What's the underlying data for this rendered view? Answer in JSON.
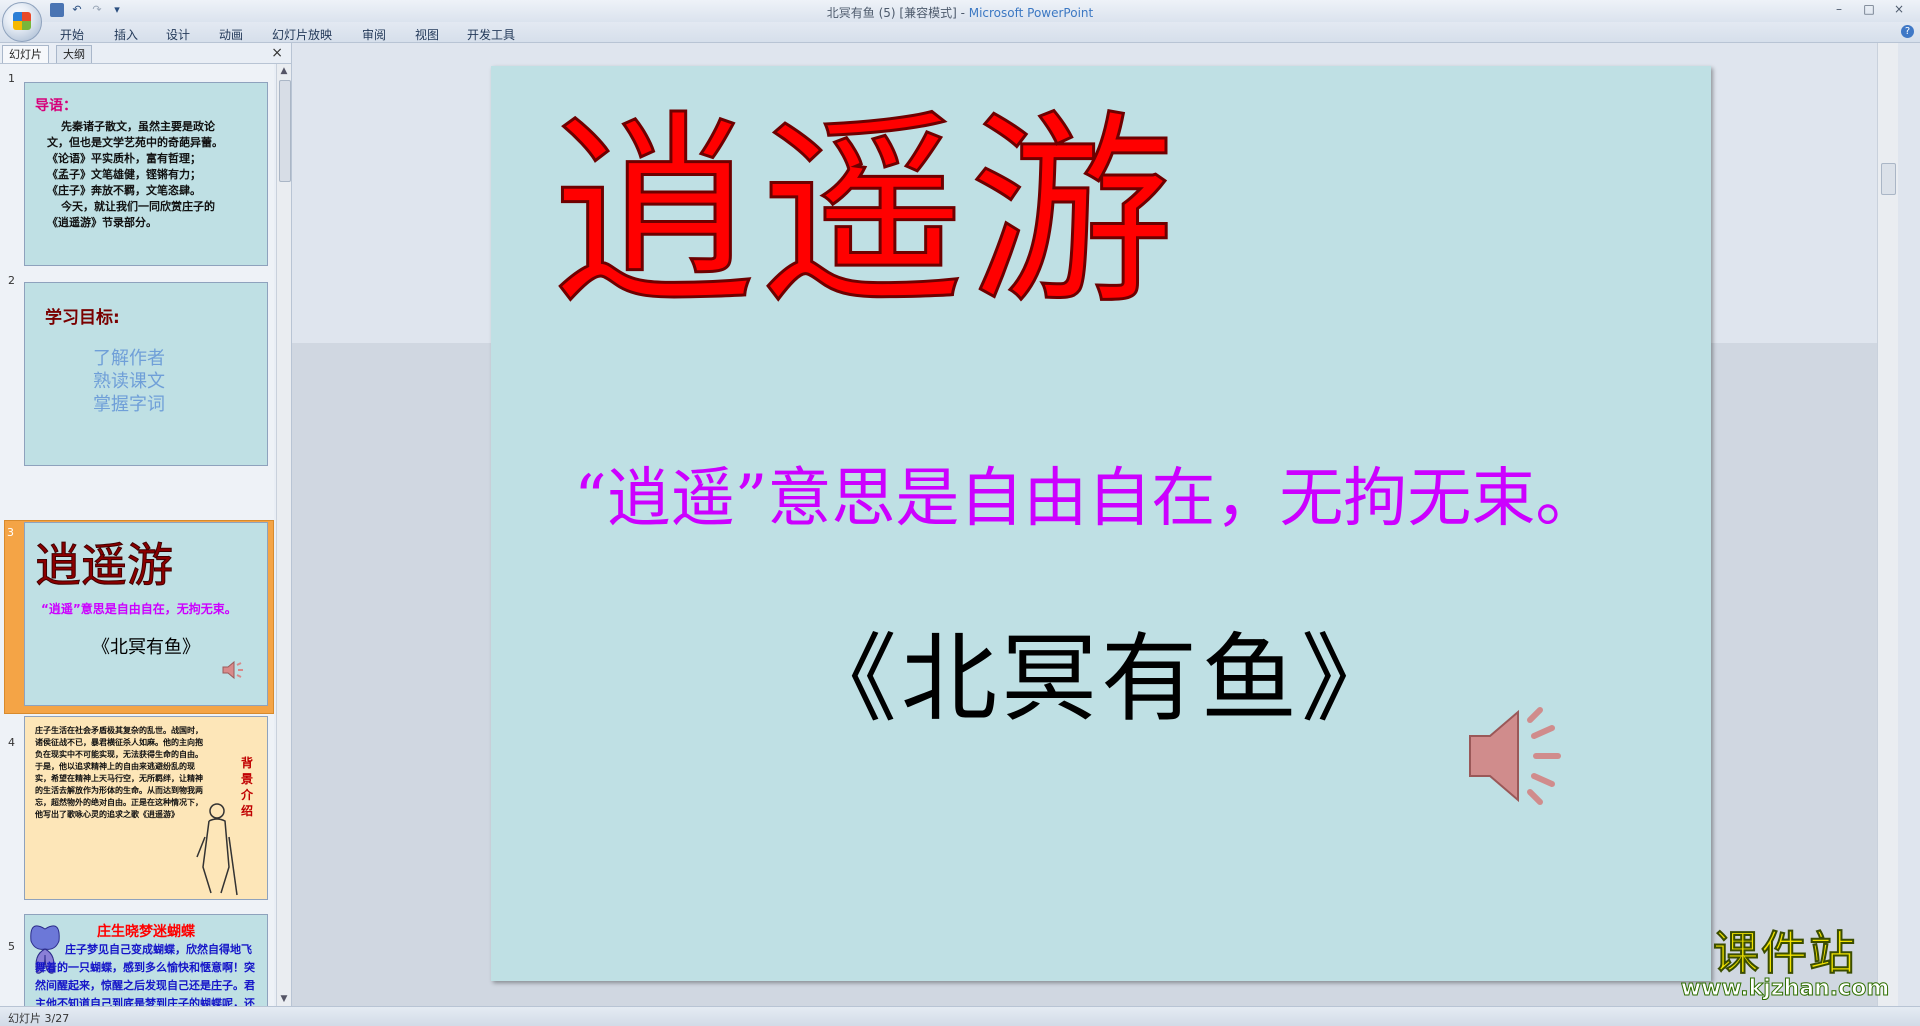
{
  "window": {
    "title": "北冥有鱼 (5) [兼容模式] - ",
    "app_name": "Microsoft PowerPoint",
    "controls": [
      "–",
      "□",
      "×"
    ]
  },
  "qat": {
    "save_icon": "save-icon",
    "undo_icon": "undo-icon",
    "redo_icon": "redo-icon",
    "customize_icon": "customize-icon"
  },
  "ribbon": {
    "tabs": [
      "开始",
      "插入",
      "设计",
      "动画",
      "幻灯片放映",
      "审阅",
      "视图",
      "开发工具"
    ],
    "help": "?"
  },
  "pane": {
    "tabs": [
      "幻灯片",
      "大纲"
    ],
    "close": "×"
  },
  "thumbnails": [
    {
      "num": "1",
      "heading": "导语：",
      "lines": [
        "先秦诸子散文，虽然主要是政论",
        "文，但也是文学艺苑中的奇葩异蕾。",
        "《论语》平实质朴，富有哲理；",
        "《孟子》文笔雄健，铿锵有力；",
        "《庄子》奔放不羁，文笔恣肆。",
        "今天，就让我们一同欣赏庄子的",
        "《逍遥游》节录部分。"
      ]
    },
    {
      "num": "2",
      "heading": "学习目标:",
      "items": [
        "了解作者",
        "熟读课文",
        "掌握字词"
      ]
    },
    {
      "num": "3",
      "title": "逍遥游",
      "desc": "“逍遥”意思是自由自在，无拘无束。",
      "subtitle": "《北冥有鱼》"
    },
    {
      "num": "4",
      "body": "庄子生活在社会矛盾极其复杂的乱世。战国时，诸侯征战不已，暴君横征杀人如麻。他的主向抱负在现实中不可能实现，无法获得生命的自由。于是，他以追求精神上的自由来逃避纷乱的现实，希望在精神上天马行空，无所羁绊，让精神的生活去解放作为形体的生命。从而达到物我两忘，超然物外的绝对自由。正是在这种情况下，他写出了歌咏心灵的追求之歌《逍遥游》",
      "side": "背景介绍"
    },
    {
      "num": "5",
      "heading": "庄生晓梦迷蝴蝶",
      "body": "庄子梦见自己变成蝴蝶，欣然自得地飞舞着的一只蝴蝶，感到多么愉快和惬意啊！突然间醒起来，惊醒之后发现自己还是庄子。君主他不知道自己到底是梦到庄子的蝴蝶呢，还是梦到蝴蝶的庄子。后以“庄生梦蝶”比喻梦中乐趣"
    }
  ],
  "slide": {
    "title": "逍遥游",
    "desc": "“逍遥”意思是自由自在，无拘无束。",
    "subtitle": "《北冥有鱼》",
    "speaker_icon": "speaker-icon"
  },
  "status": {
    "text": "幻灯片 3/27"
  },
  "watermark": {
    "big": "课件站",
    "url": "www.kjzhan.com"
  },
  "colors": {
    "slide_bg": "#bfe0e4",
    "title_red": "#ff0000",
    "desc_purple": "#cc00ff",
    "selection_orange": "#f4a446"
  }
}
